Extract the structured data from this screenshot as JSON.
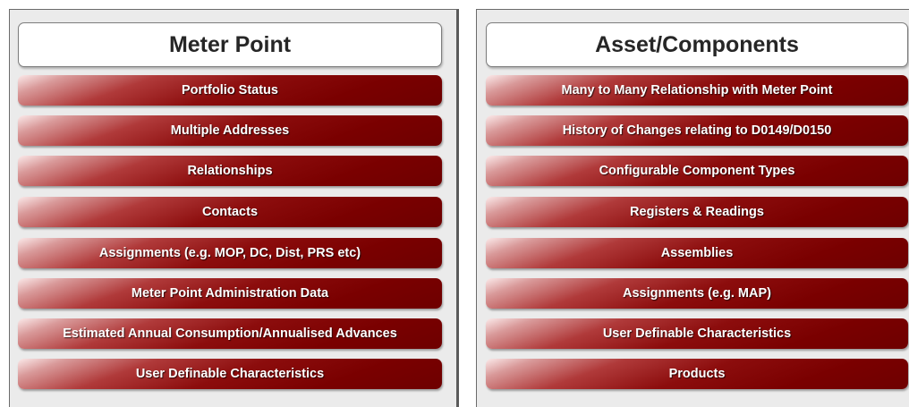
{
  "meter_point": {
    "title": "Meter Point",
    "items": [
      "Portfolio Status",
      "Multiple Addresses",
      "Relationships",
      "Contacts",
      "Assignments (e.g. MOP, DC, Dist, PRS etc)",
      "Meter Point Administration Data",
      "Estimated Annual Consumption/Annualised Advances",
      "User Definable Characteristics"
    ]
  },
  "asset_components": {
    "title": "Asset/Components",
    "items": [
      "Many to Many Relationship with Meter Point",
      "History of Changes relating to D0149/D0150",
      "Configurable Component Types",
      "Registers & Readings",
      "Assemblies",
      "Assignments (e.g. MAP)",
      "User Definable Characteristics",
      "Products"
    ]
  },
  "colors": {
    "item_dark": "#7a0000",
    "item_highlight": "#fbeaea",
    "panel_background": "#ebebeb",
    "header_background": "#ffffff"
  }
}
